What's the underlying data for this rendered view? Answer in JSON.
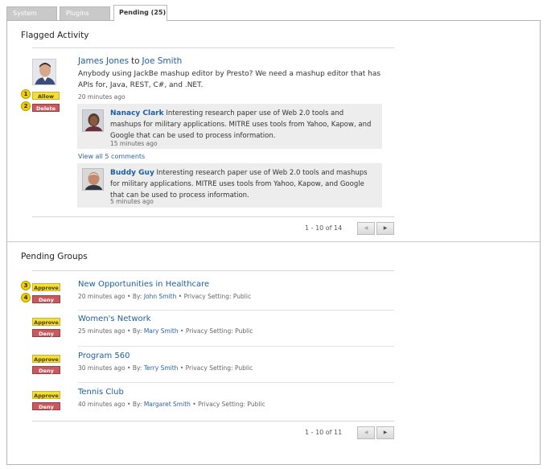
{
  "tabs": [
    {
      "label": "System"
    },
    {
      "label": "Plugins"
    },
    {
      "label": "Pending (25)"
    }
  ],
  "flagged": {
    "title": "Flagged Activity",
    "post": {
      "from": "James Jones",
      "connector": "to",
      "to": "Joe Smith",
      "text": "Anybody using JackBe mashup editor by Presto? We need a mashup editor that has APIs for, Java, REST, C#, and .NET.",
      "time": "20 minutes ago"
    },
    "allow_label": "Allow",
    "delete_label": "Delete",
    "comments": [
      {
        "name": "Nanacy Clark",
        "text": "Interesting research paper use of Web 2.0 tools and mashups for military applications. MITRE uses tools from Yahoo, Kapow, and Google that can be used to process information.",
        "time": "15 minutes ago"
      },
      {
        "name": "Buddy Guy",
        "text": "Interesting research paper use of Web 2.0 tools and mashups for military applications. MITRE uses tools from Yahoo, Kapow, and Google that can be used to process information.",
        "time": "5 minutes ago"
      }
    ],
    "view_all": "View all 5 comments",
    "pager": {
      "label": "1 - 10 of 14",
      "prev": "◀",
      "next": "▶"
    }
  },
  "pending_groups": {
    "title": "Pending Groups",
    "approve_label": "Approve",
    "deny_label": "Deny",
    "by_label": "By:",
    "separator": "•",
    "privacy_label": "Privacy Setting:",
    "groups": [
      {
        "name": "New Opportunities in Healthcare",
        "time": "20 minutes ago",
        "by": "John Smith",
        "privacy": "Public"
      },
      {
        "name": "Women's Network",
        "time": "25 minutes ago",
        "by": "Mary Smith",
        "privacy": "Public"
      },
      {
        "name": "Program 560",
        "time": "30 minutes ago",
        "by": "Terry Smith",
        "privacy": "Public"
      },
      {
        "name": "Tennis Club",
        "time": "40 minutes ago",
        "by": "Margaret Smith",
        "privacy": "Public"
      }
    ],
    "pager": {
      "label": "1 - 10 of 11",
      "prev": "◀",
      "next": "▶"
    }
  },
  "callouts": [
    "1",
    "2",
    "3",
    "4"
  ],
  "colors": {
    "link": "#1e5fa2",
    "approve": "#f3de3a",
    "deny": "#c85a5f",
    "badge": "#f2d000"
  }
}
